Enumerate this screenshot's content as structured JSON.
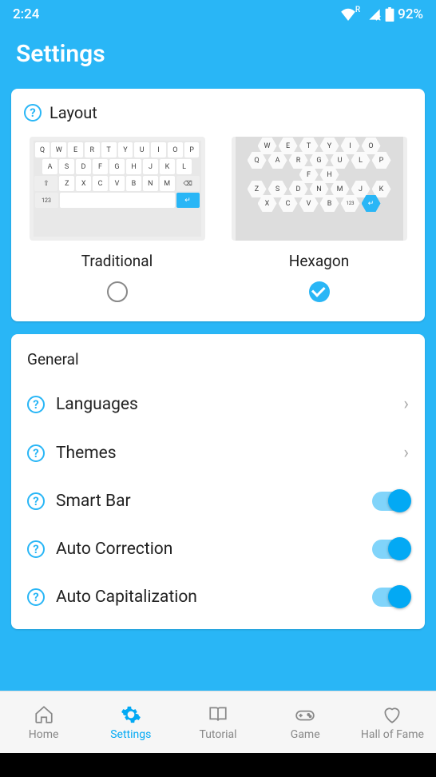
{
  "status": {
    "time": "2:24",
    "battery": "92%"
  },
  "title": "Settings",
  "layout_section": {
    "title": "Layout",
    "options": [
      {
        "label": "Traditional",
        "selected": false
      },
      {
        "label": "Hexagon",
        "selected": true
      }
    ]
  },
  "keyboard_preview": {
    "traditional": {
      "row1": [
        "Q",
        "W",
        "E",
        "R",
        "T",
        "Y",
        "U",
        "I",
        "O",
        "P"
      ],
      "row2": [
        "A",
        "S",
        "D",
        "F",
        "G",
        "H",
        "J",
        "K",
        "L"
      ],
      "row3": [
        "Z",
        "X",
        "C",
        "V",
        "B",
        "N",
        "M"
      ],
      "mode_key": "123",
      "enter_glyph": "↵"
    },
    "hexagon": {
      "row1": [
        "W",
        "E",
        "T",
        "Y",
        "I",
        "O"
      ],
      "row2": [
        "Q",
        "A",
        "R",
        "G",
        "U",
        "L",
        "P"
      ],
      "row3": [
        "F",
        "H"
      ],
      "row4": [
        "Z",
        "S",
        "D",
        "N",
        "M",
        "J",
        "K"
      ],
      "row5": [
        "X",
        "C",
        "V",
        "B",
        "123",
        "↵"
      ]
    }
  },
  "general_section": {
    "title": "General",
    "items": [
      {
        "label": "Languages",
        "type": "nav"
      },
      {
        "label": "Themes",
        "type": "nav"
      },
      {
        "label": "Smart Bar",
        "type": "toggle",
        "on": true
      },
      {
        "label": "Auto Correction",
        "type": "toggle",
        "on": true
      },
      {
        "label": "Auto Capitalization",
        "type": "toggle",
        "on": true
      }
    ]
  },
  "bottom_nav": [
    {
      "label": "Home"
    },
    {
      "label": "Settings"
    },
    {
      "label": "Tutorial"
    },
    {
      "label": "Game"
    },
    {
      "label": "Hall of Fame"
    }
  ]
}
